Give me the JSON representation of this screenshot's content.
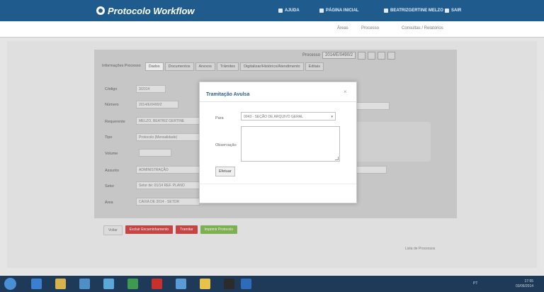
{
  "header": {
    "app_title": "Protocolo Workflow",
    "links": [
      {
        "label": "Ajuda",
        "icon": "help-icon"
      },
      {
        "label": "Página Inicial",
        "icon": "home-icon"
      },
      {
        "label": "Beatrizgertine Melzo",
        "icon": "user-icon"
      },
      {
        "label": "Sair",
        "icon": "logout-icon"
      }
    ]
  },
  "subnav": {
    "items": [
      "Áreas",
      "Processo",
      "Consultas / Relatórios"
    ]
  },
  "process_bar": {
    "label": "Processo",
    "number": "2014/E/0490/2",
    "buttons": [
      "prev-icon",
      "print-icon",
      "next-icon",
      "close-icon"
    ]
  },
  "tabs": [
    {
      "label": "Informações Processo"
    },
    {
      "label": "Dados"
    },
    {
      "label": "Documentos"
    },
    {
      "label": "Anexos"
    },
    {
      "label": "Trâmites"
    },
    {
      "label": "Digitalizar/Histórico/Atendimento"
    },
    {
      "label": "Editais"
    }
  ],
  "form": {
    "rows": [
      {
        "label": "Código",
        "value": "3/2014"
      },
      {
        "label": "Número",
        "value": "2014/E/0490/2"
      },
      {
        "label": "Requerente",
        "value": "MELZO, BEATRIZ GERTINE"
      },
      {
        "label": "Tipo",
        "value": "Protocolo (Mensalidade)"
      },
      {
        "label": "Volume",
        "value": ""
      },
      {
        "label": "Assunto",
        "value": "ADMINISTRAÇÃO"
      },
      {
        "label": "Setor",
        "value": "Setor de: 01/14 REF. PLANO"
      },
      {
        "label": "Área",
        "value": "CAIXA DE 2014 - SETOR"
      }
    ]
  },
  "actions": {
    "voltar": "Voltar",
    "buttons": [
      {
        "label": "Excluir Encaminhamento",
        "style": "red"
      },
      {
        "label": "Tramitar",
        "style": "red"
      },
      {
        "label": "Imprimir Protocolo",
        "style": "green"
      }
    ],
    "list_link": "Lista de Processos"
  },
  "modal": {
    "title": "Tramitação Avulsa",
    "para_label": "Para",
    "para_value": "0043 - SEÇÃO DE ARQUIVO GERAL",
    "obs_label": "Observação",
    "obs_value": "",
    "submit_label": "Efetuar"
  },
  "taskbar": {
    "icons": [
      "start-icon",
      "ie-icon",
      "explorer-icon",
      "folder-icon",
      "chrome-icon",
      "excel-icon",
      "acrobat-icon",
      "paint-icon",
      "notes-icon",
      "cmd-icon",
      "word-icon"
    ],
    "tray": "PT",
    "clock_time": "17:55",
    "clock_date": "03/06/2014"
  },
  "colors": {
    "header": "#1f5c8d",
    "taskbar": "#1e3a58",
    "danger": "#d24a4a",
    "success": "#84bb55"
  }
}
